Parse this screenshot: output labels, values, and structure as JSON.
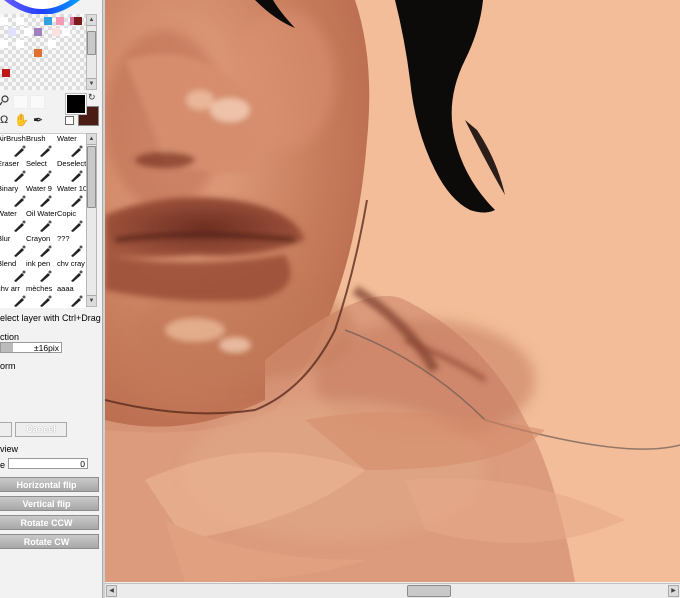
{
  "tools": {
    "items": [
      {
        "label": "AirBrush"
      },
      {
        "label": "Brush"
      },
      {
        "label": "Water"
      },
      {
        "label": "Eraser"
      },
      {
        "label": "Select"
      },
      {
        "label": "Deselect"
      },
      {
        "label": "Binary"
      },
      {
        "label": "Water 9"
      },
      {
        "label": "Water 10"
      },
      {
        "label": "Water"
      },
      {
        "label": "Oil Water"
      },
      {
        "label": "Copic"
      },
      {
        "label": "Blur"
      },
      {
        "label": "Crayon"
      },
      {
        "label": "???"
      },
      {
        "label": "Blend"
      },
      {
        "label": "ink pen"
      },
      {
        "label": "chv cray"
      },
      {
        "label": "chv arr"
      },
      {
        "label": "mèches"
      },
      {
        "label": "aaaa"
      }
    ]
  },
  "status": {
    "select_layer_hint": "elect layer with Ctrl+Drag"
  },
  "transform": {
    "rotation_label": "ction",
    "rotation_value": "±16pix",
    "transform_label": "orm",
    "cancel_label": "Cancel"
  },
  "navigator": {
    "preview_label": "view",
    "angle_label": "e",
    "angle_value": "0",
    "horizontal_flip": "Horizontal flip",
    "vertical_flip": "Vertical flip",
    "rotate_ccw": "Rotate CCW",
    "rotate_cw": "Rotate CW"
  },
  "colors": {
    "foreground": "#000000",
    "background": "#4a1c14",
    "canvas_bg": "#f2bd98",
    "palette": [
      "#ffffff",
      "#d86a9a",
      "#33a0e0",
      "#ffffff",
      "#f29ab8",
      "#7a1a1a",
      "#8a2b8a",
      "#e0e0ff",
      "#ffffff",
      "#ffe0e0",
      "#a080c0",
      "#ffffff",
      "#ffffff",
      "#ffffff",
      "#e07030",
      "#ffffff",
      "#c01818"
    ]
  },
  "icons": [
    "color-wheel-icon",
    "swap-colors-icon",
    "hand-icon",
    "rotate-icon",
    "eyedropper-icon",
    "zoom-icon",
    "brush-icon",
    "eraser-icon"
  ]
}
